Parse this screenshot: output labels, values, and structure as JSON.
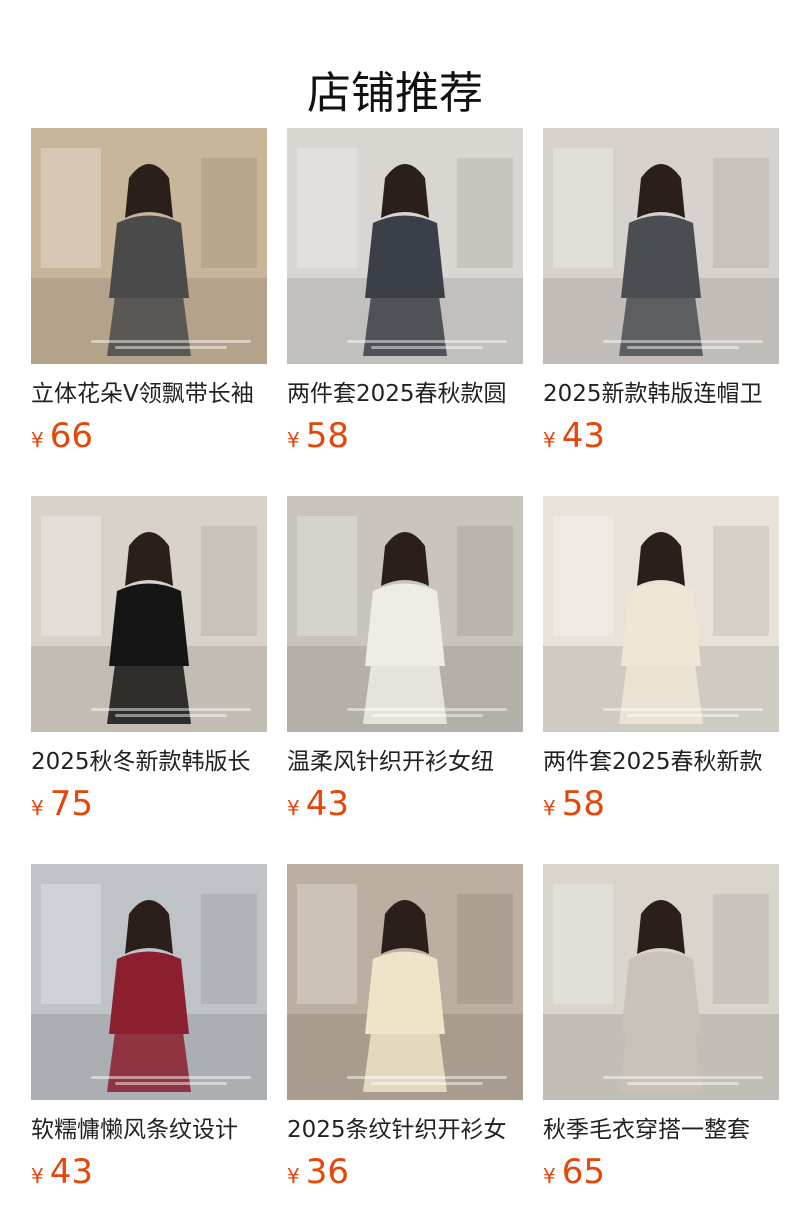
{
  "header": {
    "title": "店铺推荐"
  },
  "products": [
    {
      "name": "立体花朵V领飘带长袖",
      "currency": "¥",
      "price": "66",
      "scene": "cafe-terrace",
      "bg": "#c9b59a",
      "outfit": "#4a4a4a"
    },
    {
      "name": "两件套2025春秋款圆",
      "currency": "¥",
      "price": "58",
      "scene": "office-chair",
      "bg": "#d9d6d2",
      "outfit": "#3b4048"
    },
    {
      "name": "2025新款韩版连帽卫",
      "currency": "¥",
      "price": "43",
      "scene": "mirror-selfie",
      "bg": "#d7d2cd",
      "outfit": "#4a4d52"
    },
    {
      "name": "2025秋冬新款韩版长",
      "currency": "¥",
      "price": "75",
      "scene": "lobby",
      "bg": "#d8d2c8",
      "outfit": "#151515"
    },
    {
      "name": "温柔风针织开衫女纽",
      "currency": "¥",
      "price": "43",
      "scene": "sofa",
      "bg": "#c9c4bd",
      "outfit": "#efece6"
    },
    {
      "name": "两件套2025春秋新款",
      "currency": "¥",
      "price": "58",
      "scene": "bakery",
      "bg": "#e8e2d8",
      "outfit": "#efe6d6"
    },
    {
      "name": "软糯慵懒风条纹设计",
      "currency": "¥",
      "price": "43",
      "scene": "street",
      "bg": "#bfc3c8",
      "outfit": "#8c1f2e"
    },
    {
      "name": "2025条纹针织开衫女",
      "currency": "¥",
      "price": "36",
      "scene": "mirror-room",
      "bg": "#bcaea0",
      "outfit": "#efe4c8"
    },
    {
      "name": "秋季毛衣穿搭一整套",
      "currency": "¥",
      "price": "65",
      "scene": "kitchen",
      "bg": "#d9d4cc",
      "outfit": "#c9c2b8"
    }
  ],
  "colors": {
    "price": "#e4470a",
    "title": "#111111",
    "text": "#222222"
  }
}
